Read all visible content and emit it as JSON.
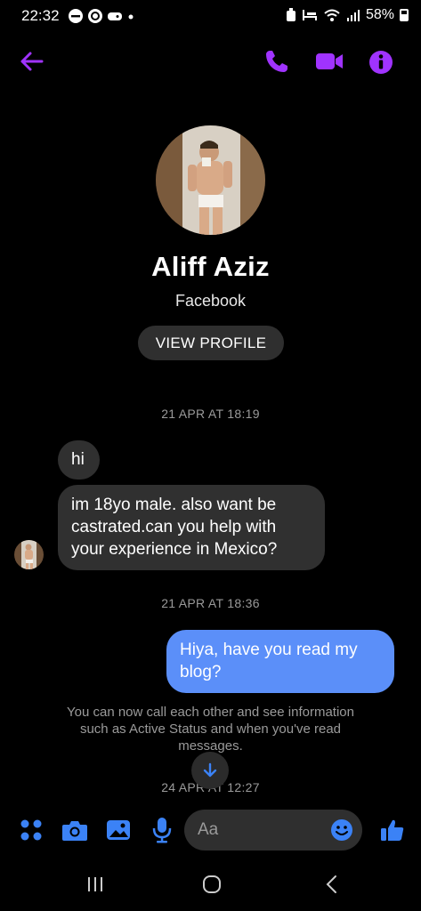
{
  "status_bar": {
    "time": "22:32",
    "battery": "58%"
  },
  "colors": {
    "accent": "#a033ff",
    "composer_blue": "#3b82f6",
    "outgoing_bubble": "#5b8ff9",
    "incoming_bubble": "#303030",
    "background": "#000000"
  },
  "icons": {
    "back": "arrow-left-icon",
    "call": "phone-icon",
    "video": "video-camera-icon",
    "info": "info-icon",
    "menu": "four-dots-menu-icon",
    "camera": "camera-icon",
    "gallery": "image-icon",
    "mic": "microphone-icon",
    "emoji": "emoji-icon",
    "like": "thumbs-up-icon",
    "scroll_down": "arrow-down-icon"
  },
  "profile": {
    "name": "Aliff  Aziz",
    "source": "Facebook",
    "view_profile_label": "VIEW PROFILE"
  },
  "conversation": {
    "timestamp_1": "21 APR AT 18:19",
    "incoming_1": "hi",
    "incoming_2": "im 18yo male. also want be castrated.can you help with your experience in Mexico?",
    "timestamp_2": "21 APR AT 18:36",
    "outgoing_1": "Hiya, have you read my blog?",
    "system_note": "You can now call each other and see information such as Active Status and when you've read messages.",
    "timestamp_3": "24 APR AT 12:27"
  },
  "composer": {
    "placeholder": "Aa"
  }
}
